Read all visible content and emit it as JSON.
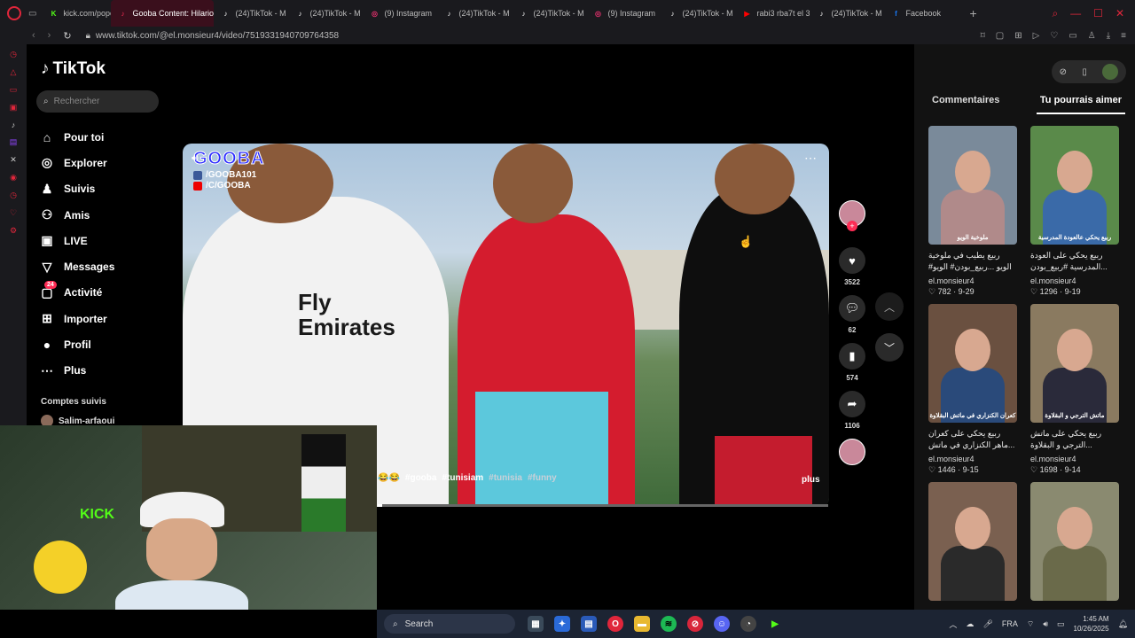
{
  "browser": {
    "tabs": [
      {
        "label": "kick.com/popo",
        "fav": "K",
        "color": "#53fc18",
        "active": false
      },
      {
        "label": "Gooba Content: Hilarious",
        "fav": "♪",
        "color": "#fe2c55",
        "active": true
      },
      {
        "label": "(24)TikTok - M",
        "fav": "♪",
        "color": "#ffffff",
        "active": false
      },
      {
        "label": "(24)TikTok - M",
        "fav": "♪",
        "color": "#ffffff",
        "active": false
      },
      {
        "label": "(9) Instagram",
        "fav": "◎",
        "color": "#e1306c",
        "active": false
      },
      {
        "label": "(24)TikTok - M",
        "fav": "♪",
        "color": "#ffffff",
        "active": false
      },
      {
        "label": "(24)TikTok - M",
        "fav": "♪",
        "color": "#ffffff",
        "active": false
      },
      {
        "label": "(9) Instagram",
        "fav": "◎",
        "color": "#e1306c",
        "active": false
      },
      {
        "label": "(24)TikTok - M",
        "fav": "♪",
        "color": "#ffffff",
        "active": false
      },
      {
        "label": "rabi3 rba7t el 3",
        "fav": "▶",
        "color": "#ff0000",
        "active": false
      },
      {
        "label": "(24)TikTok - M",
        "fav": "♪",
        "color": "#ffffff",
        "active": false
      },
      {
        "label": "Facebook",
        "fav": "f",
        "color": "#1877f2",
        "active": false
      }
    ],
    "url": "www.tiktok.com/@el.monsieur4/video/7519331940709764358"
  },
  "tiktok": {
    "logo": "TikTok",
    "search_placeholder": "Rechercher",
    "menu": [
      {
        "label": "Pour toi",
        "icon": "home-icon",
        "glyph": "⌂"
      },
      {
        "label": "Explorer",
        "icon": "compass-icon",
        "glyph": "◎"
      },
      {
        "label": "Suivis",
        "icon": "following-icon",
        "glyph": "♟"
      },
      {
        "label": "Amis",
        "icon": "friends-icon",
        "glyph": "⚇"
      },
      {
        "label": "LIVE",
        "icon": "live-icon",
        "glyph": "▣"
      },
      {
        "label": "Messages",
        "icon": "messages-icon",
        "glyph": "▽"
      },
      {
        "label": "Activité",
        "icon": "activity-icon",
        "glyph": "▢",
        "badge": "24"
      },
      {
        "label": "Importer",
        "icon": "upload-icon",
        "glyph": "⊞"
      },
      {
        "label": "Profil",
        "icon": "profile-icon",
        "glyph": "●"
      },
      {
        "label": "Plus",
        "icon": "more-icon",
        "glyph": "⋯"
      }
    ],
    "followed_heading": "Comptes suivis",
    "followed_account": "Salim-arfaoui"
  },
  "video": {
    "watermark_brand": "GOOBA",
    "watermark_line1": "/GOOBA101",
    "watermark_line2": "/C/GOOBA",
    "shirt_text": "Fly\nEmirates",
    "caption_emoji": "😂😂",
    "tags": [
      "#gooba",
      "#tunisiam",
      "#tunisia",
      "#funny"
    ],
    "more_label": "plus",
    "progress": 0.01
  },
  "actions": {
    "likes": "3522",
    "comments": "62",
    "saves": "574",
    "shares": "1106"
  },
  "panel": {
    "tab_comments": "Commentaires",
    "tab_suggested": "Tu pourrais aimer",
    "cards": [
      {
        "overlay": "ملوخية الويو",
        "desc": "ربيع يطيب في ملوخية الويو ...ربيع_بودن# الويو#",
        "author": "el.monsieur4",
        "views": "782",
        "date": "9-29",
        "bg": "#7a8a9a",
        "body": "#b08a8a"
      },
      {
        "overlay": "ربيع يحكي عالعودة المدرسية",
        "desc": "ربيع يحكي على العودة ...المدرسية #ربيع_بودن",
        "author": "el.monsieur4",
        "views": "1296",
        "date": "9-19",
        "bg": "#5a8a4a",
        "body": "#3a6aa8"
      },
      {
        "overlay": "كعران الكنزاري في ماتش البقلاوة",
        "desc": "ربيع يحكي على كعران ...ماهر الكنزاري في ماتش",
        "author": "el.monsieur4",
        "views": "1446",
        "date": "9-15",
        "bg": "#6a5040",
        "body": "#2a4a7a"
      },
      {
        "overlay": "ماتش الترجي و البقلاوة",
        "desc": "ربيع يحكي على ماتش ...الترجي و البقلاوة",
        "author": "el.monsieur4",
        "views": "1698",
        "date": "9-14",
        "bg": "#8a7a60",
        "body": "#2a2a3a"
      },
      {
        "overlay": "",
        "desc": "",
        "author": "",
        "views": "",
        "date": "",
        "bg": "#7a6050",
        "body": "#2a2a2a"
      },
      {
        "overlay": "",
        "desc": "",
        "author": "",
        "views": "",
        "date": "",
        "bg": "#8a8a70",
        "body": "#6a6a4a"
      }
    ]
  },
  "cam": {
    "sign": "KICK"
  },
  "taskbar": {
    "search_label": "Search",
    "lang": "FRA",
    "time": "1:45 AM",
    "date": "10/26/2025"
  }
}
